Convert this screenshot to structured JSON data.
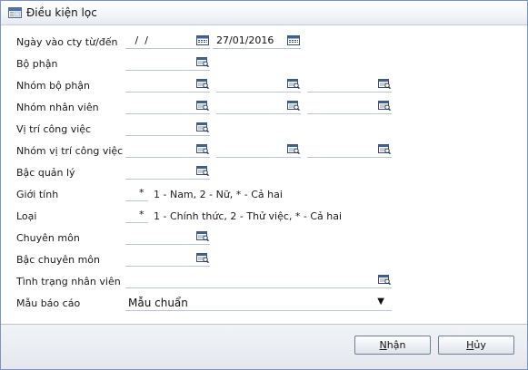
{
  "window": {
    "title": "Điều kiện lọc"
  },
  "form": {
    "date_range": {
      "label": "Ngày vào cty từ/đến",
      "from_value": " /  /",
      "to_value": "27/01/2016"
    },
    "bo_phan": {
      "label": "Bộ phận"
    },
    "nhom_bo_phan": {
      "label": "Nhóm bộ phận"
    },
    "nhom_nhan_vien": {
      "label": "Nhóm nhân viên"
    },
    "vi_tri_cong_viec": {
      "label": "Vị trí công việc"
    },
    "nhom_vi_tri_cong_viec": {
      "label": "Nhóm vị trí công việc"
    },
    "bac_quan_ly": {
      "label": "Bậc quản lý"
    },
    "gioi_tinh": {
      "label": "Giới tính",
      "value": "*",
      "hint": "1 - Nam, 2 - Nữ, * - Cả hai"
    },
    "loai": {
      "label": "Loại",
      "value": "*",
      "hint": "1 - Chính thức, 2 - Thử việc, * - Cả hai"
    },
    "chuyen_mon": {
      "label": "Chuyên môn"
    },
    "bac_chuyen_mon": {
      "label": "Bậc chuyên môn"
    },
    "tinh_trang_nhan_vien": {
      "label": "Tình trạng nhân viên"
    },
    "mau_bao_cao": {
      "label": "Mẫu báo cáo",
      "value": "Mẫu chuẩn",
      "arrow": "▼"
    }
  },
  "buttons": {
    "ok_label_underlined": "N",
    "ok_label_rest": "hận",
    "cancel_label_underlined": "H",
    "cancel_label_rest": "ủy"
  },
  "icons": {
    "calendar": "calendar-icon",
    "lookup": "lookup-icon",
    "window": "window-icon"
  }
}
